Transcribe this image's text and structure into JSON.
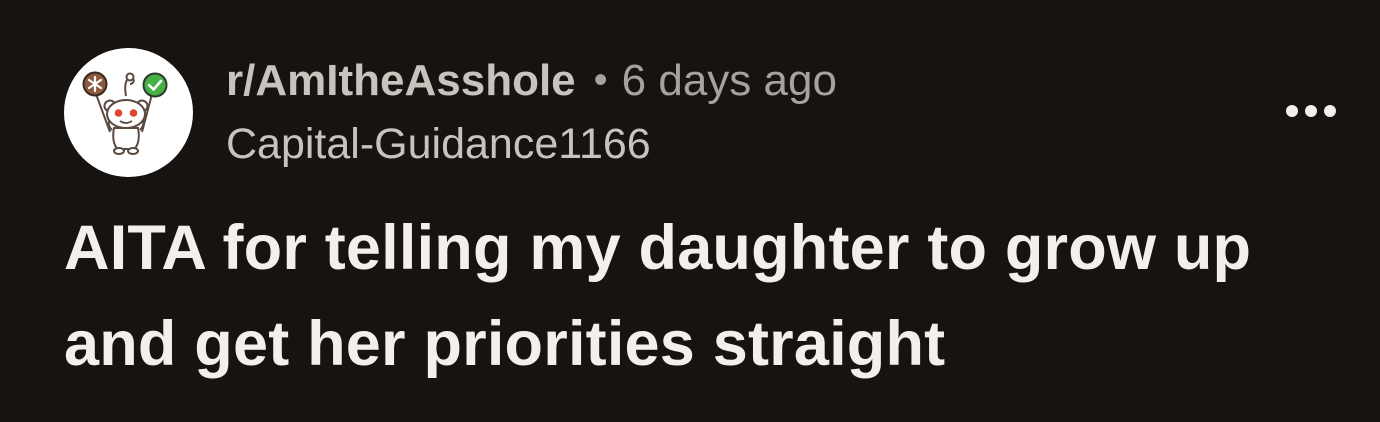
{
  "post": {
    "subreddit": "r/AmItheAsshole",
    "separator": "•",
    "time_ago": "6 days ago",
    "author": "Capital-Guidance1166",
    "title": "AITA for telling my daughter to grow up and get her priorities straight"
  },
  "icons": {
    "avatar": "reddit-snoo-holding-balloons-icon",
    "more": "ellipsis-horizontal-icon",
    "balloon_left": "asterisk-balloon-icon",
    "balloon_right": "checkmark-balloon-icon"
  },
  "colors": {
    "background": "#161310",
    "title": "#f3f0ec",
    "meta": "#c9c3bd",
    "muted": "#a8a29c",
    "balloon_brown": "#8a5a3c",
    "balloon_green": "#46b046",
    "snoo_eye": "#e0462a"
  }
}
